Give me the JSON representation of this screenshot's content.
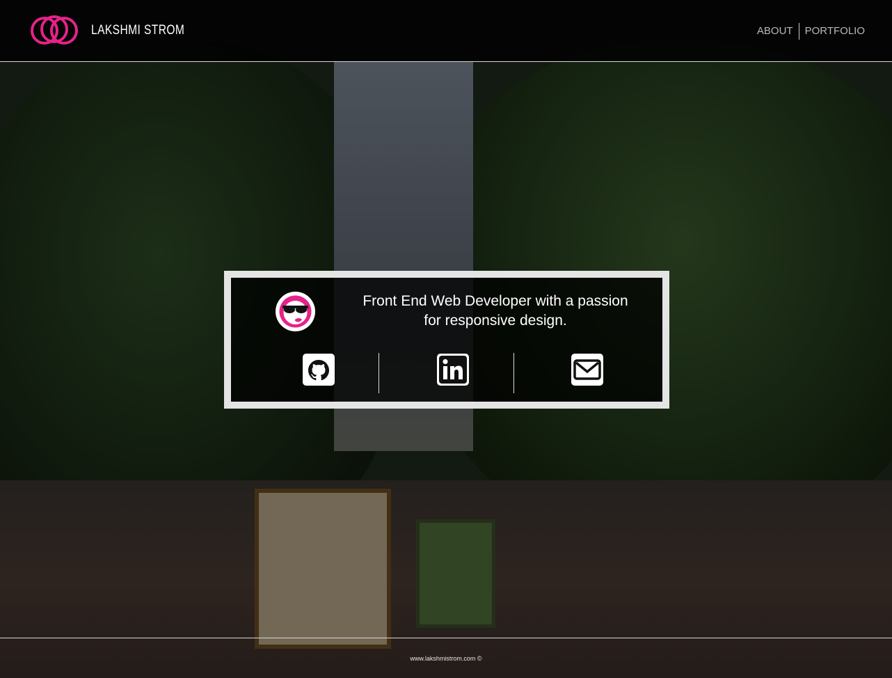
{
  "header": {
    "brand": "LAKSHMI STROM",
    "logo_icon": "interlocking-rings-logo",
    "accent_color": "#e6228a",
    "nav": [
      {
        "label": "ABOUT"
      },
      {
        "label": "PORTFOLIO"
      }
    ]
  },
  "hero": {
    "avatar_icon": "sunglasses-avatar-icon",
    "tagline_line1": "Front End Web Developer with a passion",
    "tagline_line2": "for responsive design.",
    "social_links": [
      {
        "icon": "github-icon"
      },
      {
        "icon": "linkedin-icon"
      },
      {
        "icon": "email-icon"
      }
    ]
  },
  "footer": {
    "text": "www.lakshmistrom.com ©"
  }
}
